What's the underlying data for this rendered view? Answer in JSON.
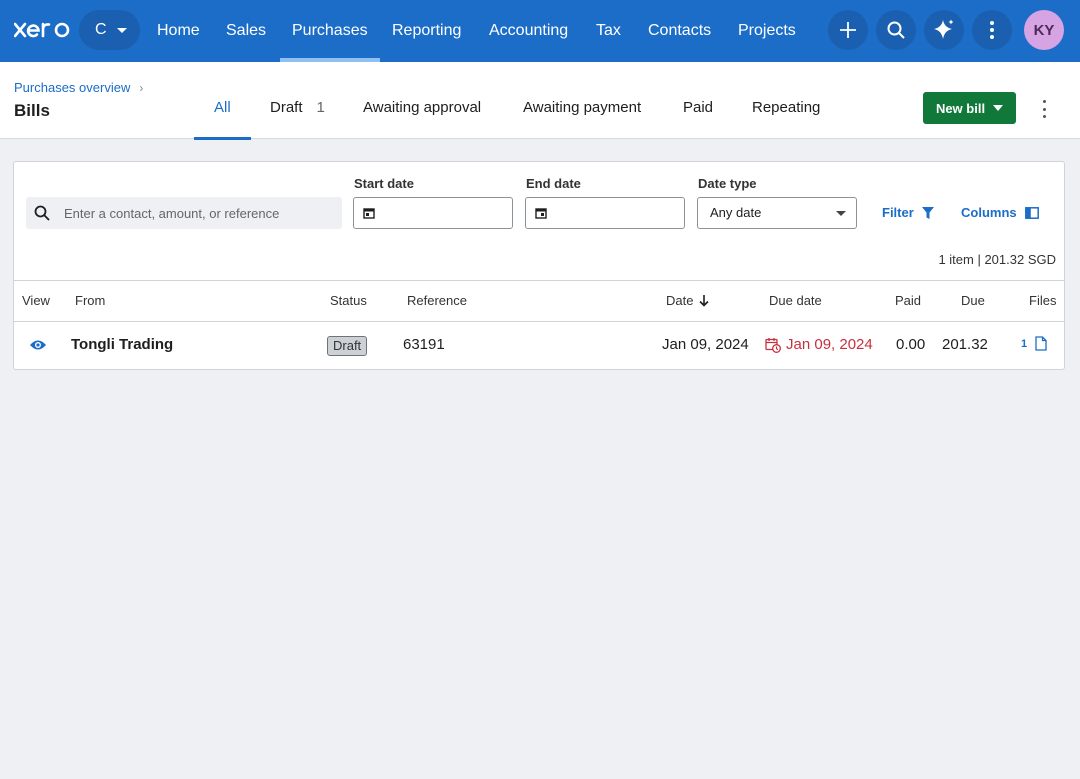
{
  "nav": {
    "org_initial": "C",
    "links": [
      "Home",
      "Sales",
      "Purchases",
      "Reporting",
      "Accounting",
      "Tax",
      "Contacts",
      "Projects"
    ],
    "active": "Purchases",
    "avatar": "KY"
  },
  "header": {
    "breadcrumb": "Purchases overview",
    "title": "Bills",
    "tabs": [
      {
        "label": "All",
        "active": true
      },
      {
        "label": "Draft",
        "count": "1"
      },
      {
        "label": "Awaiting approval"
      },
      {
        "label": "Awaiting payment"
      },
      {
        "label": "Paid"
      },
      {
        "label": "Repeating"
      }
    ],
    "new_bill_label": "New bill"
  },
  "filters": {
    "search_placeholder": "Enter a contact, amount, or reference",
    "start_date_label": "Start date",
    "end_date_label": "End date",
    "date_type_label": "Date type",
    "date_type_value": "Any date",
    "filter_label": "Filter",
    "columns_label": "Columns",
    "summary": "1 item | 201.32 SGD"
  },
  "table": {
    "headers": {
      "view": "View",
      "from": "From",
      "status": "Status",
      "reference": "Reference",
      "date": "Date",
      "due_date": "Due date",
      "paid": "Paid",
      "due": "Due",
      "files": "Files"
    },
    "rows": [
      {
        "from": "Tongli Trading",
        "status": "Draft",
        "reference": "63191",
        "date": "Jan 09, 2024",
        "due_date": "Jan 09, 2024",
        "paid": "0.00",
        "due": "201.32",
        "files": "1"
      }
    ]
  },
  "colors": {
    "brand": "#1c6dc8",
    "primary_action": "#10793a",
    "overdue": "#c9303e"
  }
}
